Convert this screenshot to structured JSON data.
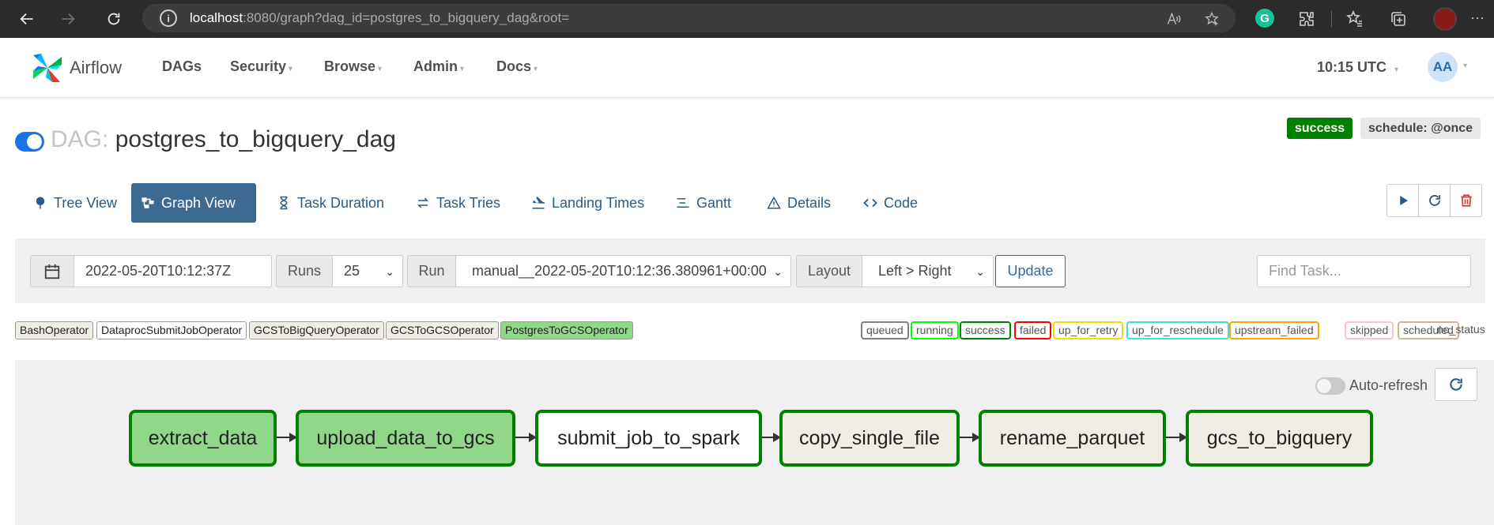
{
  "browser": {
    "url_host": "localhost",
    "url_rest": ":8080/graph?dag_id=postgres_to_bigquery_dag&root=",
    "grammarly_letter": "G",
    "more_label": "···"
  },
  "navbar": {
    "brand": "Airflow",
    "items": [
      {
        "label": "DAGs",
        "caret": false
      },
      {
        "label": "Security",
        "caret": true
      },
      {
        "label": "Browse",
        "caret": true
      },
      {
        "label": "Admin",
        "caret": true
      },
      {
        "label": "Docs",
        "caret": true
      }
    ],
    "clock": "10:15 UTC",
    "avatar_initials": "AA"
  },
  "dag": {
    "prefix": "DAG:",
    "id": "postgres_to_bigquery_dag",
    "state_badge": "success",
    "schedule_badge": "schedule: @once",
    "paused": false
  },
  "tabs": [
    {
      "label": "Tree View",
      "icon": "tree-icon",
      "active": false
    },
    {
      "label": "Graph View",
      "icon": "graph-icon",
      "active": true
    },
    {
      "label": "Task Duration",
      "icon": "hourglass-icon",
      "active": false
    },
    {
      "label": "Task Tries",
      "icon": "retry-icon",
      "active": false
    },
    {
      "label": "Landing Times",
      "icon": "plane-icon",
      "active": false
    },
    {
      "label": "Gantt",
      "icon": "gantt-icon",
      "active": false
    },
    {
      "label": "Details",
      "icon": "warning-icon",
      "active": false
    },
    {
      "label": "Code",
      "icon": "code-icon",
      "active": false
    }
  ],
  "filters": {
    "base_date": "2022-05-20T10:12:37Z",
    "runs_label": "Runs",
    "runs_value": "25",
    "run_label": "Run",
    "run_value": "manual__2022-05-20T10:12:36.380961+00:00",
    "layout_label": "Layout",
    "layout_value": "Left > Right",
    "update_label": "Update",
    "find_placeholder": "Find Task..."
  },
  "operators": [
    {
      "label": "BashOperator",
      "color": "#f0ede4"
    },
    {
      "label": "DataprocSubmitJobOperator",
      "color": "#ffffff"
    },
    {
      "label": "GCSToBigQueryOperator",
      "color": "#f0ede4"
    },
    {
      "label": "GCSToGCSOperator",
      "color": "#f0ede4"
    },
    {
      "label": "PostgresToGCSOperator",
      "color": "#90d78a"
    }
  ],
  "states": [
    {
      "label": "queued",
      "color": "#808080"
    },
    {
      "label": "running",
      "color": "#00ff00"
    },
    {
      "label": "success",
      "color": "#008000"
    },
    {
      "label": "failed",
      "color": "#ff0000"
    },
    {
      "label": "up_for_retry",
      "color": "#ffd700"
    },
    {
      "label": "up_for_reschedule",
      "color": "#40e0d0"
    },
    {
      "label": "upstream_failed",
      "color": "#ffa500"
    },
    {
      "label": "skipped",
      "color": "#ffc0cb"
    },
    {
      "label": "scheduled",
      "color": "#d2b48c"
    },
    {
      "label": "no_status",
      "color": ""
    }
  ],
  "graph": {
    "auto_refresh_label": "Auto-refresh",
    "auto_refresh_on": false,
    "tasks": [
      {
        "label": "extract_data",
        "fill": "#90d78a",
        "state": "success"
      },
      {
        "label": "upload_data_to_gcs",
        "fill": "#90d78a",
        "state": "success"
      },
      {
        "label": "submit_job_to_spark",
        "fill": "#ffffff",
        "state": "success"
      },
      {
        "label": "copy_single_file",
        "fill": "#f0ede4",
        "state": "success"
      },
      {
        "label": "rename_parquet",
        "fill": "#f0ede4",
        "state": "success"
      },
      {
        "label": "gcs_to_bigquery",
        "fill": "#f0ede4",
        "state": "success"
      }
    ]
  }
}
